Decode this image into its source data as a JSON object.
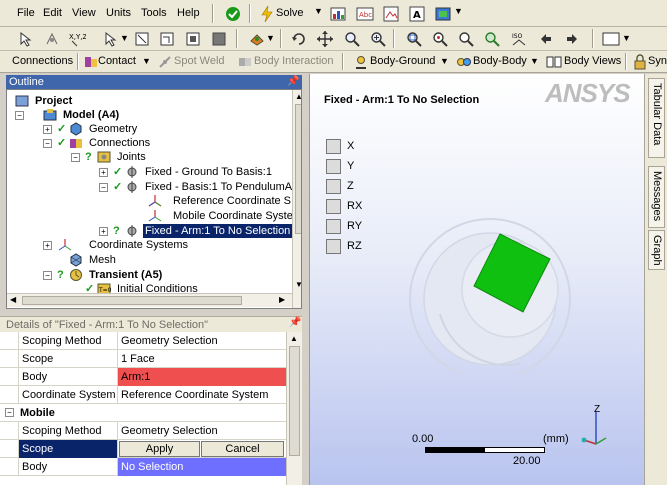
{
  "menu": [
    "File",
    "Edit",
    "View",
    "Units",
    "Tools",
    "Help"
  ],
  "toolbar1": {
    "solve_label": "Solve"
  },
  "toolbar2": {
    "connections_label": "Connections",
    "contact_label": "Contact",
    "spot_weld_label": "Spot Weld",
    "body_interaction_label": "Body Interaction",
    "body_ground_label": "Body-Ground",
    "body_body_label": "Body-Body",
    "body_views_label": "Body Views",
    "syn_label": "Syn"
  },
  "outline": {
    "title": "Outline",
    "items": [
      {
        "label": "Project"
      },
      {
        "label": "Model (A4)"
      },
      {
        "label": "Geometry"
      },
      {
        "label": "Connections"
      },
      {
        "label": "Joints"
      },
      {
        "label": "Fixed - Ground To Basis:1"
      },
      {
        "label": "Fixed - Basis:1 To PendulumA"
      },
      {
        "label": "Reference Coordinate S"
      },
      {
        "label": "Mobile Coordinate Syste"
      },
      {
        "label": "Fixed - Arm:1 To No Selection"
      },
      {
        "label": "Coordinate Systems"
      },
      {
        "label": "Mesh"
      },
      {
        "label": "Transient (A5)"
      },
      {
        "label": "Initial Conditions"
      }
    ]
  },
  "details": {
    "title": "Details of \"Fixed - Arm:1 To No Selection\"",
    "rows": [
      {
        "key": "Scoping Method",
        "value": "Geometry Selection"
      },
      {
        "key": "Scope",
        "value": "1 Face"
      },
      {
        "key": "Body",
        "value": "Arm:1"
      },
      {
        "key": "Coordinate System",
        "value": "Reference Coordinate System"
      }
    ],
    "group_mobile": "Mobile",
    "mobile_rows": [
      {
        "key": "Scoping Method",
        "value": "Geometry Selection"
      },
      {
        "key": "Scope",
        "apply_label": "Apply",
        "cancel_label": "Cancel"
      },
      {
        "key": "Body",
        "value": "No Selection"
      }
    ]
  },
  "graphics": {
    "title": "Fixed - Arm:1 To No Selection",
    "logo": "ANSYS",
    "dof": [
      "X",
      "Y",
      "Z",
      "RX",
      "RY",
      "RZ"
    ],
    "scale": {
      "start": "0.00",
      "end": "20.00",
      "unit": "(mm)"
    },
    "triad_label": "Z"
  },
  "right_tabs": [
    "Tabular Data",
    "Messages",
    "Graph"
  ],
  "colors": {
    "arm_face": "#10c010",
    "body_red": "#ef4f4f",
    "no_selection": "#6f6fff",
    "selection_blue": "#0a246a"
  }
}
